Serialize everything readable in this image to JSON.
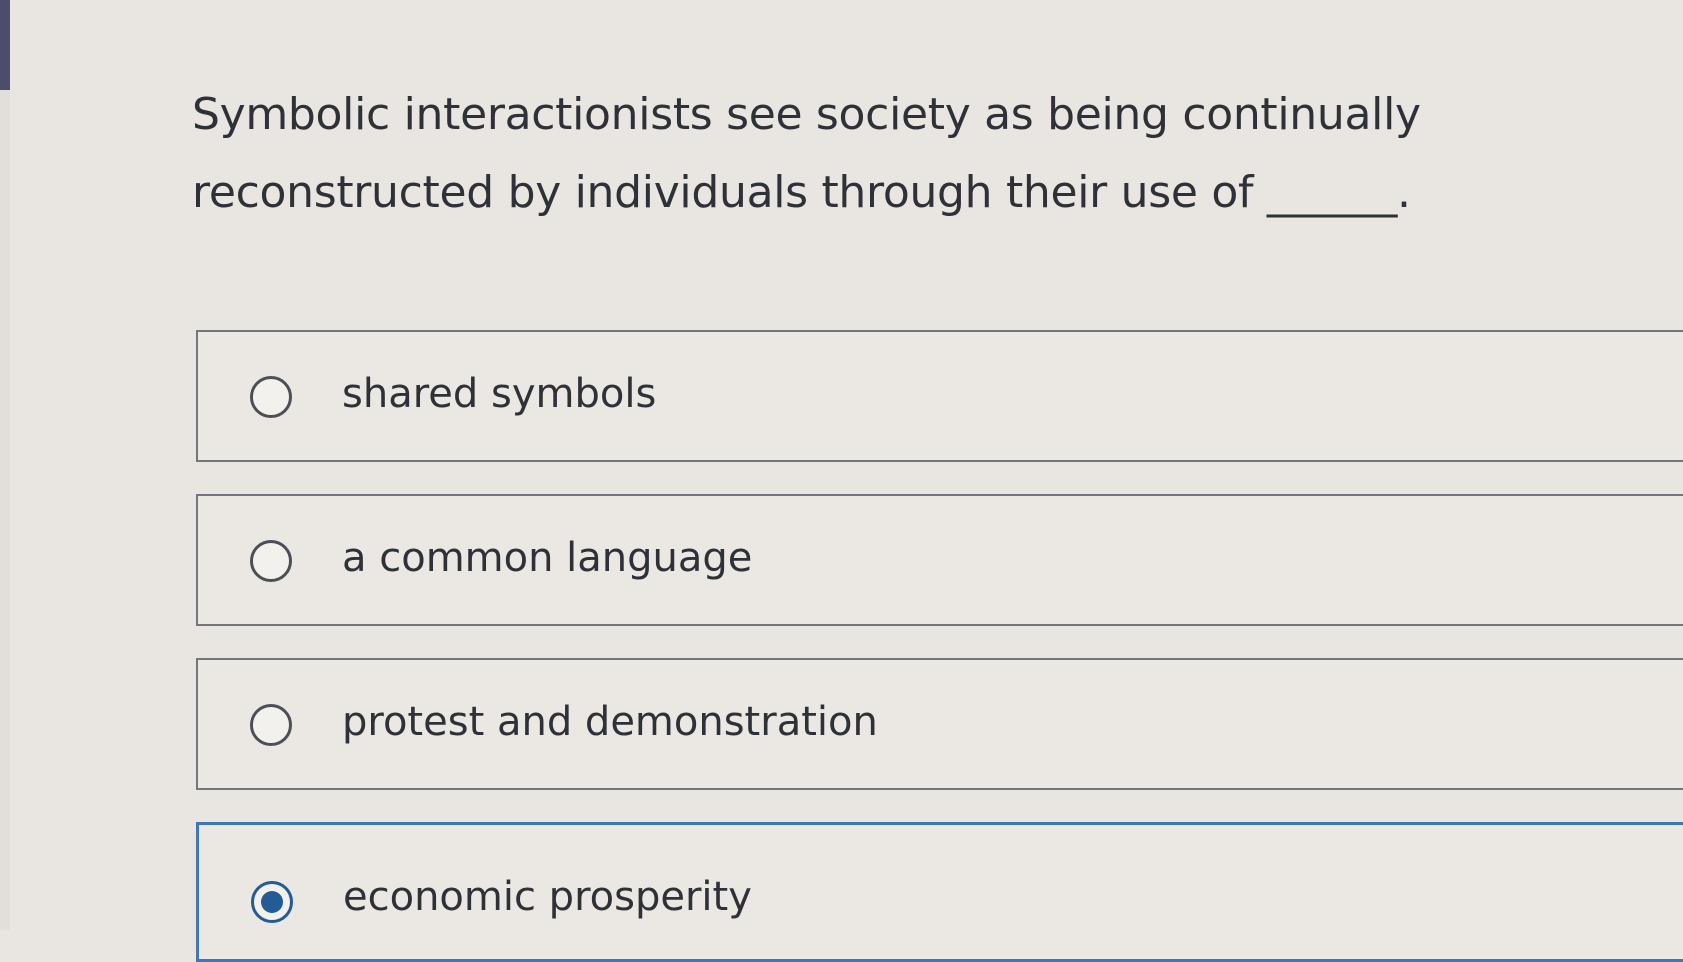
{
  "question": {
    "text": "Symbolic interactionists see society as being continually reconstructed by individuals through their use of ______."
  },
  "options": [
    {
      "label": "shared symbols",
      "selected": false
    },
    {
      "label": "a common language",
      "selected": false
    },
    {
      "label": "protest and demonstration",
      "selected": false
    },
    {
      "label": "economic prosperity",
      "selected": true
    }
  ],
  "colors": {
    "selected_accent": "#235b97",
    "selected_border": "#3f78b8",
    "background": "#e9e6e1"
  }
}
